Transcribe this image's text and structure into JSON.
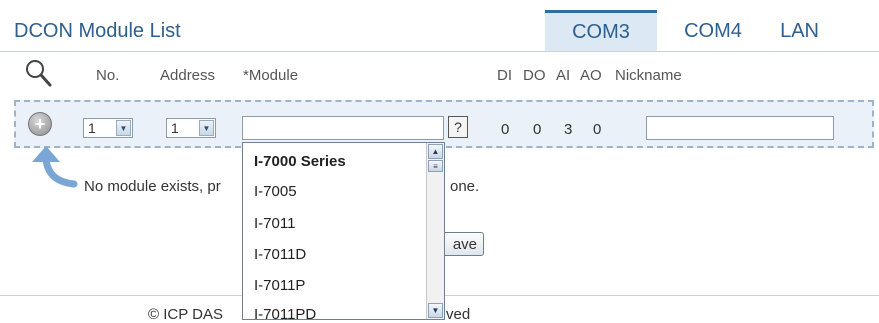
{
  "page": {
    "title": "DCON Module List",
    "tabs": [
      {
        "label": "COM3",
        "active": true
      },
      {
        "label": "COM4",
        "active": false
      },
      {
        "label": "LAN",
        "active": false
      }
    ]
  },
  "table": {
    "search_icon": "magnifier-icon",
    "headers": {
      "no": "No.",
      "address": "Address",
      "module": "*Module",
      "di": "DI",
      "do": "DO",
      "ai": "AI",
      "ao": "AO",
      "nickname": "Nickname"
    }
  },
  "new_row": {
    "add_icon": "plus-circle-icon",
    "no_value": "1",
    "address_value": "1",
    "module_value": "",
    "help_label": "?",
    "di": "0",
    "do": "0",
    "ai": "3",
    "ao": "0",
    "nickname_value": ""
  },
  "module_dropdown": {
    "options": [
      "I-7000 Series",
      "I-7005",
      "I-7011",
      "I-7011D",
      "I-7011P",
      "I-7011PD"
    ]
  },
  "message": {
    "visible_start": "No module exists, pr",
    "visible_end": "one.",
    "arrow_icon": "curved-arrow-icon"
  },
  "save_button_label": "ave",
  "footer": {
    "start": "© ICP DAS",
    "end": "ved"
  },
  "colors": {
    "accent": "#2e5f8e",
    "tab_active_bg": "#dce8f3",
    "row_bg": "#eaf1f8"
  }
}
